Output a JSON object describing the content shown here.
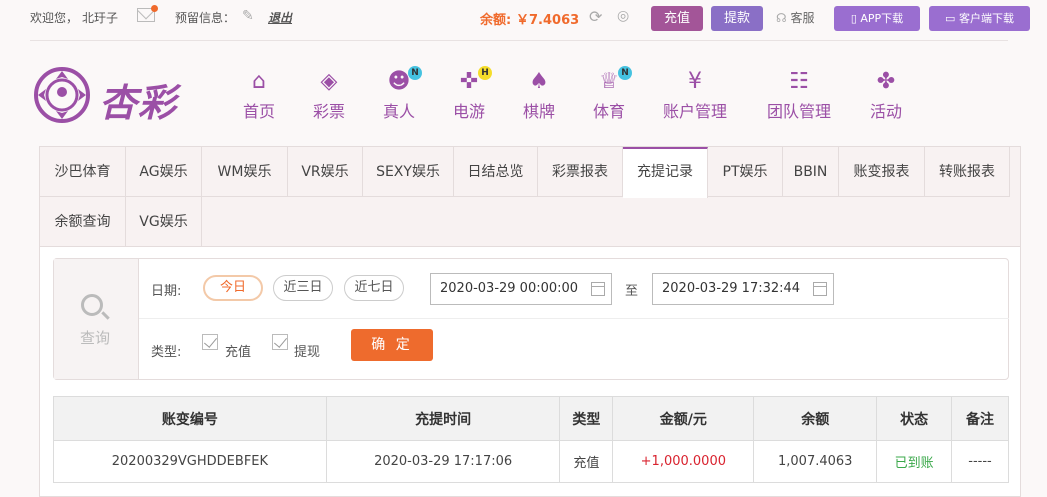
{
  "topbar": {
    "welcome": "欢迎您，",
    "username": "北玗子",
    "reserve_label": "预留信息：",
    "logout": "退出",
    "balance_label": "余额:",
    "balance_value": "￥7.4063",
    "recharge": "充值",
    "withdraw": "提款",
    "service": "客服",
    "app_download": "APP下载",
    "client_download": "客户端下载"
  },
  "logo": {
    "text": "杏彩"
  },
  "nav": [
    {
      "label": "首页",
      "icon": "home-icon",
      "badge": ""
    },
    {
      "label": "彩票",
      "icon": "ticket-icon",
      "badge": ""
    },
    {
      "label": "真人",
      "icon": "dealer-icon",
      "badge": "N"
    },
    {
      "label": "电游",
      "icon": "gamepad-icon",
      "badge": "H"
    },
    {
      "label": "棋牌",
      "icon": "cards-icon",
      "badge": ""
    },
    {
      "label": "体育",
      "icon": "trophy-icon",
      "badge": "N"
    },
    {
      "label": "账户管理",
      "icon": "yen-icon",
      "badge": ""
    },
    {
      "label": "团队管理",
      "icon": "team-icon",
      "badge": ""
    },
    {
      "label": "活动",
      "icon": "gift-icon",
      "badge": ""
    }
  ],
  "tabs": [
    "沙巴体育",
    "AG娱乐",
    "WM娱乐",
    "VR娱乐",
    "SEXY娱乐",
    "日结总览",
    "彩票报表",
    "充提记录",
    "PT娱乐",
    "BBIN",
    "账变报表",
    "转账报表",
    "余额查询",
    "VG娱乐"
  ],
  "active_tab": "充提记录",
  "search": {
    "query_label": "查询",
    "date_label": "日期:",
    "today": "今日",
    "three_days": "近三日",
    "seven_days": "近七日",
    "start_date": "2020-03-29 00:00:00",
    "to": "至",
    "end_date": "2020-03-29 17:32:44",
    "type_label": "类型:",
    "type_recharge": "充值",
    "type_withdraw": "提现",
    "confirm": "确 定"
  },
  "table": {
    "headers": [
      "账变编号",
      "充提时间",
      "类型",
      "金额/元",
      "余额",
      "状态",
      "备注"
    ],
    "rows": [
      [
        "20200329VGHDDEBFEK",
        "2020-03-29 17:17:06",
        "充值",
        "+1,000.0000",
        "1,007.4063",
        "已到账",
        "-----"
      ]
    ]
  }
}
